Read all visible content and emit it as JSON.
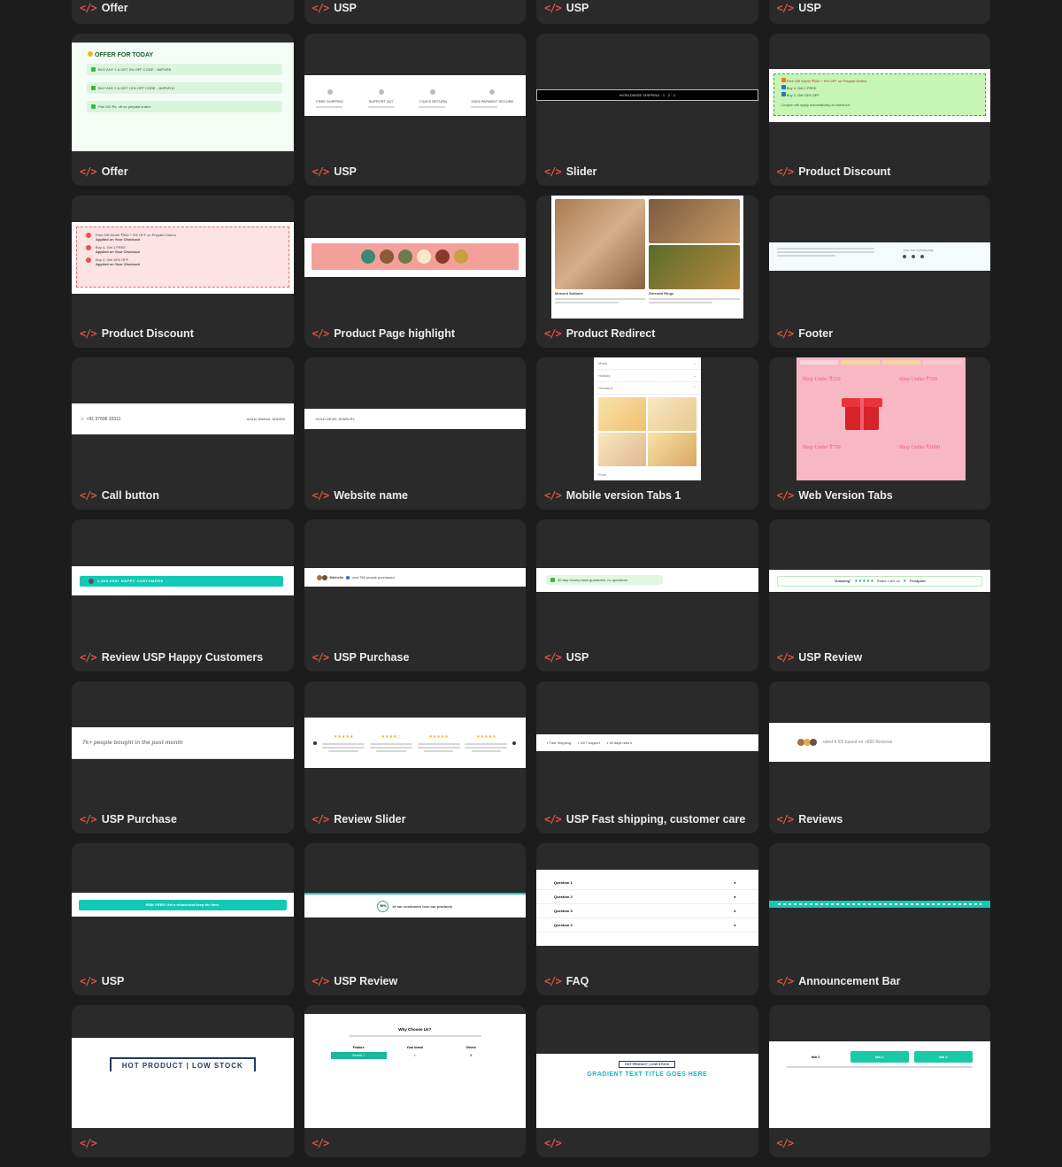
{
  "cards": [
    {
      "label": "Offer"
    },
    {
      "label": "USP"
    },
    {
      "label": "USP"
    },
    {
      "label": "USP"
    },
    {
      "label": "Offer"
    },
    {
      "label": "USP"
    },
    {
      "label": "Slider"
    },
    {
      "label": "Product Discount"
    },
    {
      "label": "Product Discount"
    },
    {
      "label": "Product Page highlight"
    },
    {
      "label": "Product Redirect"
    },
    {
      "label": "Footer"
    },
    {
      "label": "Call button"
    },
    {
      "label": "Website name"
    },
    {
      "label": "Mobile version Tabs 1"
    },
    {
      "label": "Web Version Tabs"
    },
    {
      "label": "Review USP Happy Customers"
    },
    {
      "label": "USP Purchase"
    },
    {
      "label": "USP"
    },
    {
      "label": "USP Review"
    },
    {
      "label": "USP Purchase"
    },
    {
      "label": "Review Slider"
    },
    {
      "label": "USP Fast shipping, customer care"
    },
    {
      "label": "Reviews"
    },
    {
      "label": "USP"
    },
    {
      "label": "USP Review"
    },
    {
      "label": "FAQ"
    },
    {
      "label": "Announcement Bar"
    },
    {
      "label": ""
    },
    {
      "label": ""
    },
    {
      "label": ""
    },
    {
      "label": ""
    }
  ],
  "previews": {
    "offer": {
      "title": "OFFER FOR TODAY",
      "items": [
        "BUY ANY 1 & GET 5% OFF CODE : JAIPUR5",
        "BUY ANY 2 & GET 10% OFF CODE : JAIPUR10",
        "Flat 100 Rs. off on prepaid orders"
      ]
    },
    "usp_icons": [
      "FREE SHIPPING",
      "SUPPORT 24/7",
      "7 DAYS RETURN",
      "100% PAYMENT SECURE"
    ],
    "slider_text": "WORLDWIDE SHIPPING · 1 · 2 · 3",
    "product_discount_green": {
      "items": [
        "Free Gift Worth ₹500 + 5% OFF on Prepaid Orders",
        "Buy 4, Get 1 FREE",
        "Buy 2, Get 15% OFF"
      ],
      "note": "Coupon will apply automatically at checkout"
    },
    "product_discount_pink": [
      {
        "title": "Free Gift Worth ₹500 + 5% OFF on Prepaid Orders",
        "sub": "Applied on Your Checkout"
      },
      {
        "title": "Buy 4, Get 1 FREE",
        "sub": "Applied on Your Checkout"
      },
      {
        "title": "Buy 2, Get 15% OFF",
        "sub": "Applied on Your Checkout"
      }
    ],
    "redirect_captions": [
      "Mossed Solitaire",
      "Emerald Rings"
    ],
    "footer_text": "Join our community",
    "call": {
      "phone": "+91 97696 33311",
      "wishlist": "Add to Wishlist",
      "added": "ADDED!"
    },
    "website_name": "GOLD DEVIE JEWELRY",
    "mobile_tabs": [
      "Metal",
      "Holiday",
      "Occasion",
      "Price"
    ],
    "web_tabs": [
      "Shop Under ₹250",
      "Shop Under ₹500",
      "Shop Under ₹750",
      "Shop Under ₹1000"
    ],
    "happy_customers": "1,000,000+ HAPPY CUSTOMERS",
    "usp_purchase": {
      "name": "Michelle",
      "text": "and 758 people purchased"
    },
    "money_back": "30-day money back guarantee, no questions",
    "usp_review": {
      "word": "\"Amazing\"",
      "text": "Rated 4.6/5 on",
      "brand": "Trustpilot"
    },
    "bought": "7k+ people bought in the past month",
    "fast_shipping": [
      "Fast Shipping",
      "24/7 support",
      "30 days return"
    ],
    "reviews": "rated 4.5/5 based on +650 Reviews",
    "risk_free": "RISK FREE!   Get a refund and keep the item.",
    "usp_review_pct": {
      "pct": "90%",
      "text": "of our customers love our products"
    },
    "faq": [
      "Question 1",
      "Question 2",
      "Question 3",
      "Question 4"
    ],
    "hot_product": "HOT PRODUCT | LOW STOCK",
    "why_choose": {
      "title": "Why Choose Us?",
      "cols": [
        "Feature",
        "Your brand",
        "Others"
      ],
      "row": "Benefit 1"
    },
    "gradient_title": {
      "badge": "HOT PRODUCT | LOW STOCK",
      "title": "GRADIENT TEXT TITLE GOES HERE"
    },
    "tabs_row": [
      "tab 1",
      "tab 2",
      "tab 3"
    ]
  },
  "colors": {
    "background": "#1c1c1c",
    "card": "#2a2a2a",
    "accent": "#e2513f",
    "green": "#39b54a",
    "teal": "#12c9b6"
  }
}
